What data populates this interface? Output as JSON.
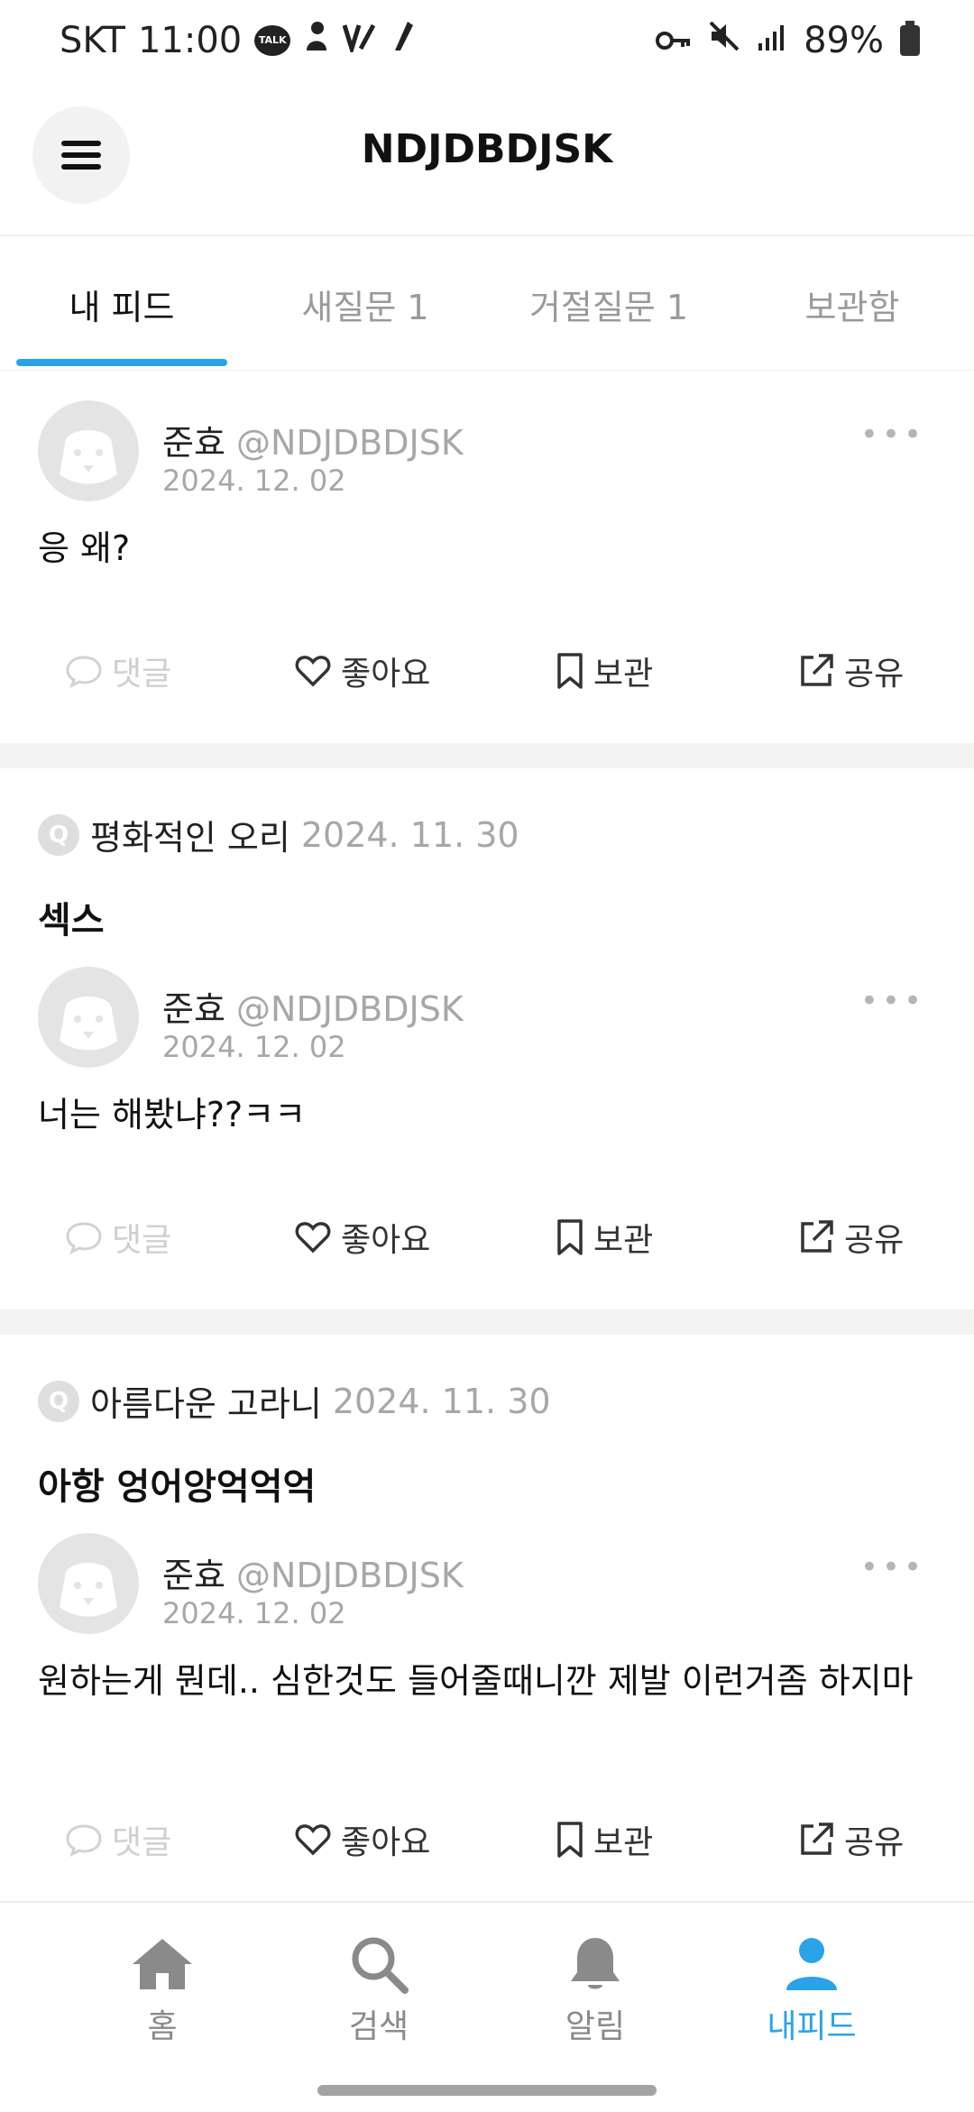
{
  "status_bar": {
    "carrier": "SKT",
    "time": "11:00",
    "talk_badge": "TALK",
    "battery": "89%"
  },
  "header": {
    "title": "NDJDBDJSK"
  },
  "tabs": [
    {
      "label": "내 피드",
      "active": true
    },
    {
      "label": "새질문 1",
      "active": false
    },
    {
      "label": "거절질문 1",
      "active": false
    },
    {
      "label": "보관함",
      "active": false
    }
  ],
  "feed": [
    {
      "question": null,
      "author_name": "준효",
      "author_handle": "@NDJDBDJSK",
      "answer_date": "2024. 12. 02",
      "answer": "응 왜?"
    },
    {
      "question": {
        "asker": "평화적인 오리",
        "date": "2024. 11. 30",
        "text": "섹스",
        "badge": "Q"
      },
      "author_name": "준효",
      "author_handle": "@NDJDBDJSK",
      "answer_date": "2024. 12. 02",
      "answer": "너는 해봤냐??ㅋㅋ"
    },
    {
      "question": {
        "asker": "아름다운 고라니",
        "date": "2024. 11. 30",
        "text": "아항 엉어앙억억억",
        "badge": "Q"
      },
      "author_name": "준효",
      "author_handle": "@NDJDBDJSK",
      "answer_date": "2024. 12. 02",
      "answer": "원하는게 뭔데.. 심한것도 들어줄때니깐 제발 이런거좀 하지마"
    }
  ],
  "actions": {
    "comment": "댓글",
    "like": "좋아요",
    "save": "보관",
    "share": "공유",
    "more": "•••"
  },
  "bottom_nav": [
    {
      "label": "홈",
      "icon": "home-icon",
      "active": false
    },
    {
      "label": "검색",
      "icon": "search-icon",
      "active": false
    },
    {
      "label": "알림",
      "icon": "bell-icon",
      "active": false
    },
    {
      "label": "내피드",
      "icon": "person-icon",
      "active": true
    }
  ],
  "colors": {
    "accent": "#2ba3e8",
    "muted": "#a7a7a7"
  }
}
